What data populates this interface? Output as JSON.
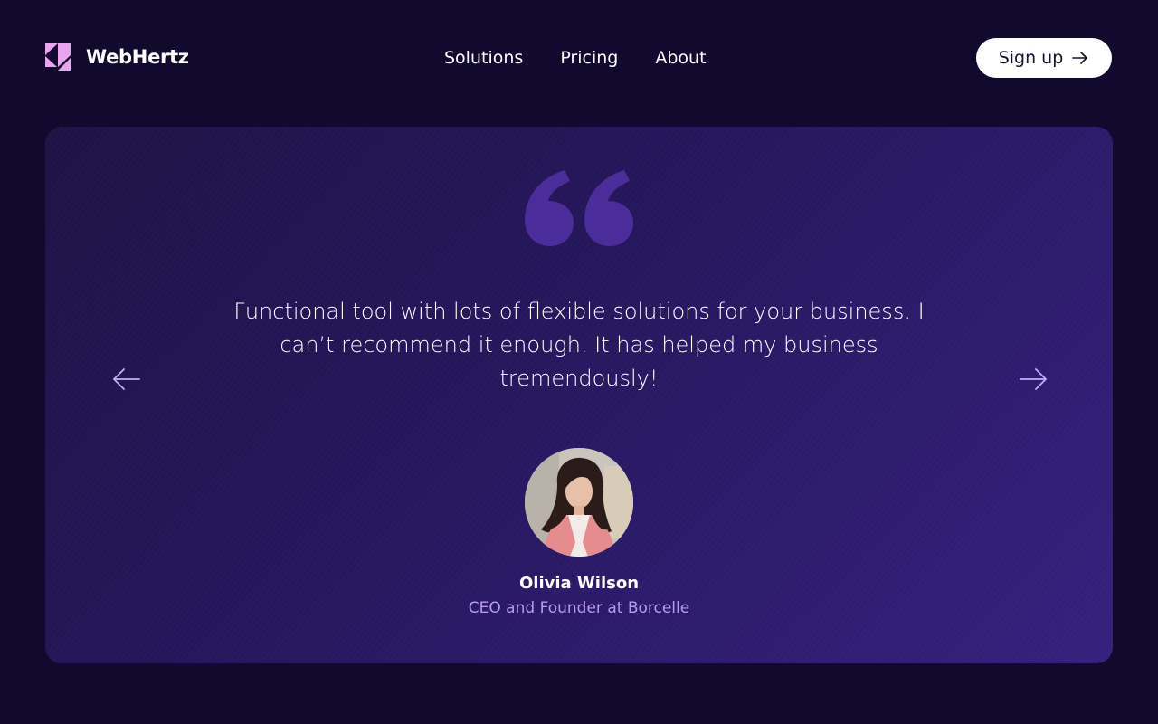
{
  "brand": {
    "name": "WebHertz",
    "logo_icon": "webhertz-logo-icon",
    "logo_color": "#e9a5ee"
  },
  "nav": {
    "items": [
      {
        "label": "Solutions"
      },
      {
        "label": "Pricing"
      },
      {
        "label": "About"
      }
    ]
  },
  "header": {
    "signup_label": "Sign up",
    "signup_icon": "arrow-right-icon"
  },
  "testimonial": {
    "quote_icon": "quote-mark-icon",
    "quote": "Functional tool with lots of flexible solutions for your business. I can’t recommend it enough. It has helped my business tremendously!",
    "author_name": "Olivia Wilson",
    "author_role": "CEO and Founder at Borcelle",
    "prev_icon": "arrow-left-icon",
    "next_icon": "arrow-right-icon"
  },
  "colors": {
    "page_background": "#110a2e",
    "card_gradient_start": "#1e1346",
    "card_gradient_end": "#37207f",
    "quote_mark": "#4a2d9a",
    "accent_text": "#b79af2",
    "arrow": "#c3aef5",
    "button_background": "#ffffff"
  }
}
